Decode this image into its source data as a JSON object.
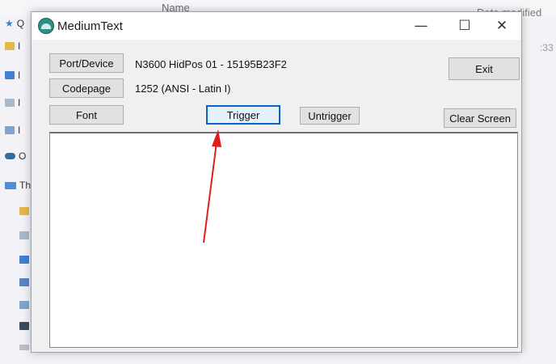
{
  "background_explorer": {
    "header_name": "Name",
    "header_date": "Date modified",
    "time_fragment": ":33",
    "quick_access_fragment": "Q",
    "onedrive_fragment": "O",
    "this_pc_fragment": "Th",
    "item_fragment": "I"
  },
  "window": {
    "title": "MediumText",
    "minimize_glyph": "—",
    "maximize_glyph": "☐",
    "close_glyph": "✕"
  },
  "buttons": {
    "port_device": "Port/Device",
    "codepage": "Codepage",
    "font": "Font",
    "trigger": "Trigger",
    "untrigger": "Untrigger",
    "exit": "Exit",
    "clear_screen": "Clear Screen"
  },
  "info": {
    "device": "N3600 HidPos 01 - 15195B23F2",
    "codepage": "1252  (ANSI - Latin I)"
  },
  "annotation": {
    "arrow_color": "#e01e1e",
    "focus_color": "#0a64c8"
  }
}
